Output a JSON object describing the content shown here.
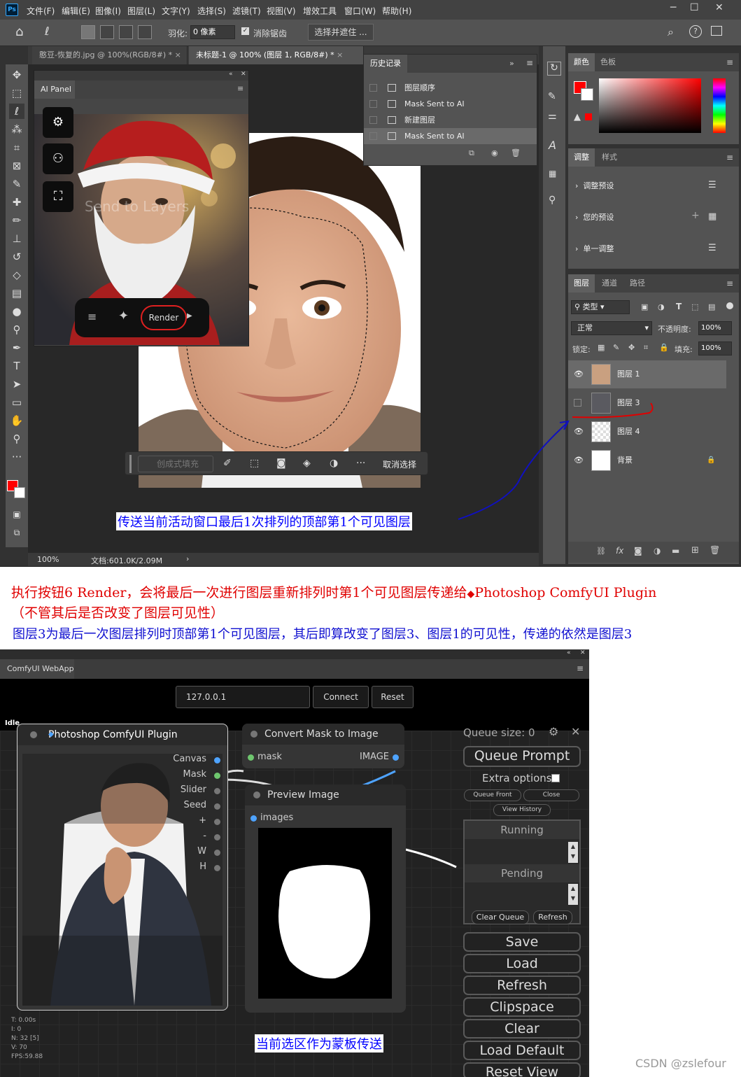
{
  "ps": {
    "logo": "Ps",
    "menus": [
      "文件(F)",
      "编辑(E)",
      "图像(I)",
      "图层(L)",
      "文字(Y)",
      "选择(S)",
      "滤镜(T)",
      "视图(V)",
      "增效工具",
      "窗口(W)",
      "帮助(H)"
    ],
    "options": {
      "feather_label": "羽化:",
      "feather_value": "0 像素",
      "antialias_label": "消除锯齿",
      "select_mask_button": "选择并遮住 ..."
    },
    "tabs": [
      "憨豆-恢复的.jpg @ 100%(RGB/8#) *",
      "未标题-1 @ 100% (图层 1, RGB/8#) *"
    ],
    "status": {
      "zoom": "100%",
      "doc": "文档:601.0K/2.09M"
    },
    "ai_panel": {
      "tab": "AI Panel",
      "overlay_text": "Send to Layers",
      "render_label": "Render"
    },
    "history": {
      "title": "历史记录",
      "items": [
        "图层顺序",
        "Mask Sent to AI",
        "新建图层",
        "Mask Sent to AI"
      ]
    },
    "context_bar": {
      "generative_fill": "创成式填充",
      "deselect": "取消选择",
      "more": "···"
    },
    "color_panel": {
      "tabs": [
        "颜色",
        "色板"
      ],
      "foreground": "#ff0000"
    },
    "adjust_panel": {
      "tabs": [
        "调整",
        "样式"
      ],
      "items": [
        "调整预设",
        "您的预设",
        "单一调整"
      ]
    },
    "layers_panel": {
      "tabs": [
        "图层",
        "通道",
        "路径"
      ],
      "filter": "类型",
      "blend_mode": "正常",
      "opacity_label": "不透明度:",
      "opacity_value": "100%",
      "lock_label": "锁定:",
      "fill_label": "填充:",
      "fill_value": "100%",
      "layers": [
        {
          "name": "图层 1",
          "visible": true
        },
        {
          "name": "图层 3",
          "visible": false
        },
        {
          "name": "图层 4",
          "visible": true
        },
        {
          "name": "背景",
          "visible": true
        }
      ]
    }
  },
  "annotations": {
    "blue_label": "传送当前活动窗口最后1次排列的顶部第1个可见图层",
    "red_line1": "执行按钮6 Render，会将最后一次进行图层重新排列时第1个可见图层传递给",
    "red_line1_b": "Photoshop ComfyUI Plugin",
    "red_line2": "（不管其后是否改变了图层可见性）",
    "blue_line3": "图层3为最后一次图层排列时顶部第1个可见图层，其后即算改变了图层3、图层1的可见性，传递的依然是图层3",
    "mask_label": "当前选区作为蒙板传送",
    "watermark": "CSDN @zslefour"
  },
  "comfy": {
    "tab": "ComfyUI WebApp",
    "server": "127.0.0.1",
    "connect": "Connect",
    "reset": "Reset",
    "status": "Idle",
    "plugin_node": {
      "title": "Photoshop ComfyUI Plugin",
      "outputs": [
        "Canvas",
        "Mask",
        "Slider",
        "Seed",
        "+",
        "-",
        "W",
        "H"
      ]
    },
    "convert_node": {
      "title": "Convert Mask to Image",
      "input": "mask",
      "output": "IMAGE"
    },
    "preview_node": {
      "title": "Preview Image",
      "input": "images"
    },
    "queue": {
      "size": "Queue size: 0",
      "queue_prompt": "Queue Prompt",
      "extra_options": "Extra options",
      "queue_front": "Queue Front",
      "close": "Close",
      "view_history": "View History",
      "running": "Running",
      "pending": "Pending",
      "clear_queue": "Clear Queue",
      "refresh_small": "Refresh",
      "buttons": [
        "Save",
        "Load",
        "Refresh",
        "Clipspace",
        "Clear",
        "Load Default",
        "Reset View"
      ]
    },
    "stats": [
      "T: 0.00s",
      "I: 0",
      "N: 32 [5]",
      "V: 70",
      "FPS:59.88"
    ]
  }
}
